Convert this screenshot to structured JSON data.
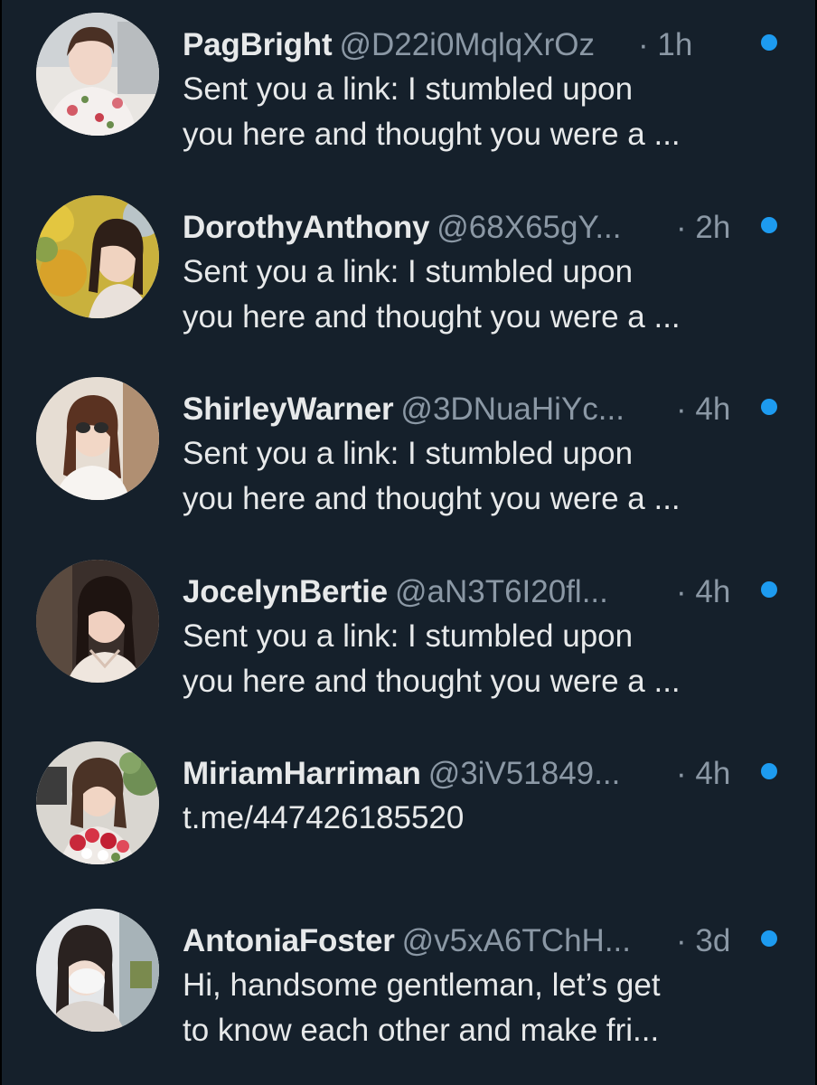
{
  "colors": {
    "background": "#15202b",
    "primary_text": "#e7e9ea",
    "secondary_text": "#8b98a5",
    "unread_dot": "#1d9bf0"
  },
  "conversations": [
    {
      "name": "PagBright",
      "handle": "@D22i0MqlqXrOz",
      "time": "· 1h",
      "preview_lines": [
        "Sent you a link: I stumbled upon",
        "you here and thought you were a ..."
      ],
      "unread": true,
      "avatar_icon": "profile-photo"
    },
    {
      "name": "DorothyAnthony",
      "handle": "@68X65gY...",
      "time": "· 2h",
      "preview_lines": [
        "Sent you a link: I stumbled upon",
        "you here and thought you were a ..."
      ],
      "unread": true,
      "avatar_icon": "profile-photo"
    },
    {
      "name": "ShirleyWarner",
      "handle": "@3DNuaHiYc...",
      "time": "· 4h",
      "preview_lines": [
        "Sent you a link: I stumbled upon",
        "you here and thought you were a ..."
      ],
      "unread": true,
      "avatar_icon": "profile-photo"
    },
    {
      "name": "JocelynBertie",
      "handle": "@aN3T6I20fl...",
      "time": "· 4h",
      "preview_lines": [
        "Sent you a link: I stumbled upon",
        "you here and thought you were a ..."
      ],
      "unread": true,
      "avatar_icon": "profile-photo"
    },
    {
      "name": "MiriamHarriman",
      "handle": "@3iV51849...",
      "time": "· 4h",
      "preview_lines": [
        "t.me/447426185520"
      ],
      "unread": true,
      "avatar_icon": "profile-photo"
    },
    {
      "name": "AntoniaFoster",
      "handle": "@v5xA6TChH...",
      "time": "· 3d",
      "preview_lines": [
        "Hi, handsome gentleman, let’s get",
        "to know each other and make fri..."
      ],
      "unread": true,
      "avatar_icon": "profile-photo"
    }
  ]
}
